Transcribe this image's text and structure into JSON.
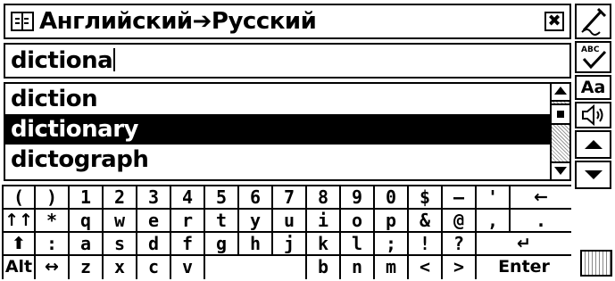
{
  "window": {
    "title": "Английский➔Русский",
    "close_label": "✖"
  },
  "search": {
    "value": "dictiona"
  },
  "suggestions": [
    {
      "label": "diction",
      "selected": false
    },
    {
      "label": "dictionary",
      "selected": true
    },
    {
      "label": "dictograph",
      "selected": false
    }
  ],
  "toolbar": {
    "items": [
      {
        "name": "handwriting-icon"
      },
      {
        "name": "spellcheck-icon",
        "label": "ABC"
      },
      {
        "name": "font-size-button",
        "label": "Aa"
      },
      {
        "name": "speaker-icon"
      },
      {
        "name": "scroll-up-button"
      },
      {
        "name": "scroll-down-button"
      }
    ]
  },
  "keyboard": {
    "rows": [
      [
        "(",
        ")",
        "1",
        "2",
        "3",
        "4",
        "5",
        "6",
        "7",
        "8",
        "9",
        "0",
        "$",
        "–",
        "'",
        "←"
      ],
      [
        "↑↑",
        "*",
        "q",
        "w",
        "e",
        "r",
        "t",
        "y",
        "u",
        "i",
        "o",
        "p",
        "&",
        "@",
        ",",
        "."
      ],
      [
        "⬆",
        ":",
        "a",
        "s",
        "d",
        "f",
        "g",
        "h",
        "j",
        "k",
        "l",
        ";",
        "!",
        "?",
        "↵"
      ],
      [
        "Alt",
        "↔",
        "z",
        "x",
        "c",
        "v",
        "",
        "b",
        "n",
        "m",
        "<",
        ">",
        "Enter"
      ]
    ]
  }
}
